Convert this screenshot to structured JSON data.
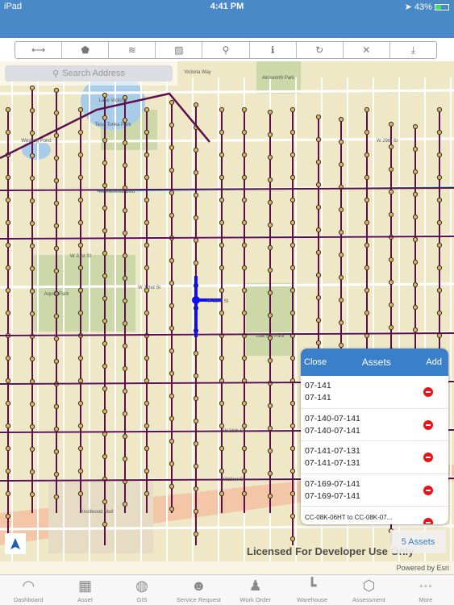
{
  "status_bar": {
    "device": "iPad",
    "time": "4:41 PM",
    "battery": "43%"
  },
  "toolbar": {
    "tools": [
      {
        "name": "measure-icon",
        "glyph": "⟷"
      },
      {
        "name": "polygon-icon",
        "glyph": "⬟"
      },
      {
        "name": "layers-icon",
        "glyph": "≋"
      },
      {
        "name": "basemap-icon",
        "glyph": "▨"
      },
      {
        "name": "pin-icon",
        "glyph": "⚲"
      },
      {
        "name": "info-icon",
        "glyph": "ℹ"
      },
      {
        "name": "refresh-icon",
        "glyph": "↻"
      },
      {
        "name": "clear-icon",
        "glyph": "✕"
      },
      {
        "name": "download-icon",
        "glyph": "⤓"
      }
    ]
  },
  "search": {
    "placeholder": "Search Address"
  },
  "map": {
    "labels": [
      "Lake Victoria",
      "Tesa-Tonka Park",
      "Westing Pond",
      "Ainsworth Park",
      "Victoria Way",
      "Minnetonka Blvd",
      "W 29th St",
      "W 31st St",
      "W 32nd St",
      "W 33rd St",
      "Aquila Park",
      "Oak Hill Park",
      "W 36th St",
      "Walker St",
      "Knollwood Mall"
    ],
    "license": "Licensed For Developer Use Only",
    "attribution": "Powered by Esri",
    "colors": {
      "pipe": "#5c0f4a",
      "selected": "#1010ee",
      "water": "#3cc0e8"
    }
  },
  "assets_panel": {
    "close": "Close",
    "title": "Assets",
    "add": "Add",
    "items": [
      {
        "line1": "07-141",
        "line2": "07-141"
      },
      {
        "line1": "07-140-07-141",
        "line2": "07-140-07-141"
      },
      {
        "line1": "07-141-07-131",
        "line2": "07-141-07-131"
      },
      {
        "line1": "07-169-07-141",
        "line2": "07-169-07-141"
      },
      {
        "line1": "CC-08K-06HT to CC-08K-07...",
        "line2": ""
      }
    ]
  },
  "assets_button": "5 Assets",
  "tabs": [
    {
      "label": "Dashboard",
      "icon": "gauge-icon"
    },
    {
      "label": "Asset",
      "icon": "building-icon"
    },
    {
      "label": "GIS",
      "icon": "globe-pin-icon"
    },
    {
      "label": "Service Request",
      "icon": "person-chat-icon"
    },
    {
      "label": "Work Order",
      "icon": "worker-icon"
    },
    {
      "label": "Warehouse",
      "icon": "pipe-icon"
    },
    {
      "label": "Assessment",
      "icon": "hands-box-icon"
    },
    {
      "label": "More",
      "icon": "more-icon"
    }
  ]
}
